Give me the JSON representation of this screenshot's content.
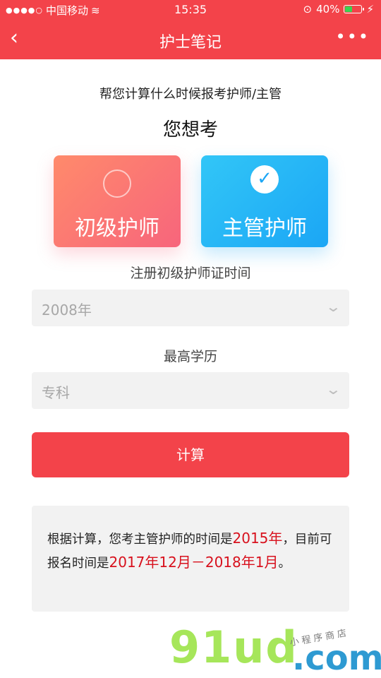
{
  "status_bar": {
    "carrier": "中国移动",
    "time": "15:35",
    "battery": "40%"
  },
  "nav": {
    "title": "护士笔记"
  },
  "intro": {
    "subtitle": "帮您计算什么时候报考护师/主管",
    "heading": "您想考"
  },
  "options": [
    {
      "label": "初级护师",
      "selected": false
    },
    {
      "label": "主管护师",
      "selected": true
    }
  ],
  "form": {
    "register_label": "注册初级护师证时间",
    "register_value": "2008年",
    "education_label": "最高学历",
    "education_value": "专科"
  },
  "calc_button_label": "计算",
  "result": {
    "prefix": "根据计算，您考主管护师的时间是",
    "exam_year": "2015年",
    "middle": "，目前可报名时间是",
    "period": "2017年12月－2018年1月",
    "suffix": "。"
  },
  "watermark": {
    "brand": "91ud",
    "domain": ".com",
    "tagline": "小程序商店"
  },
  "colors": {
    "accent": "#f3434a",
    "nurse_card": "#f7657c",
    "supervisor_card": "#1ba6f5",
    "highlight": "#d8111d"
  }
}
